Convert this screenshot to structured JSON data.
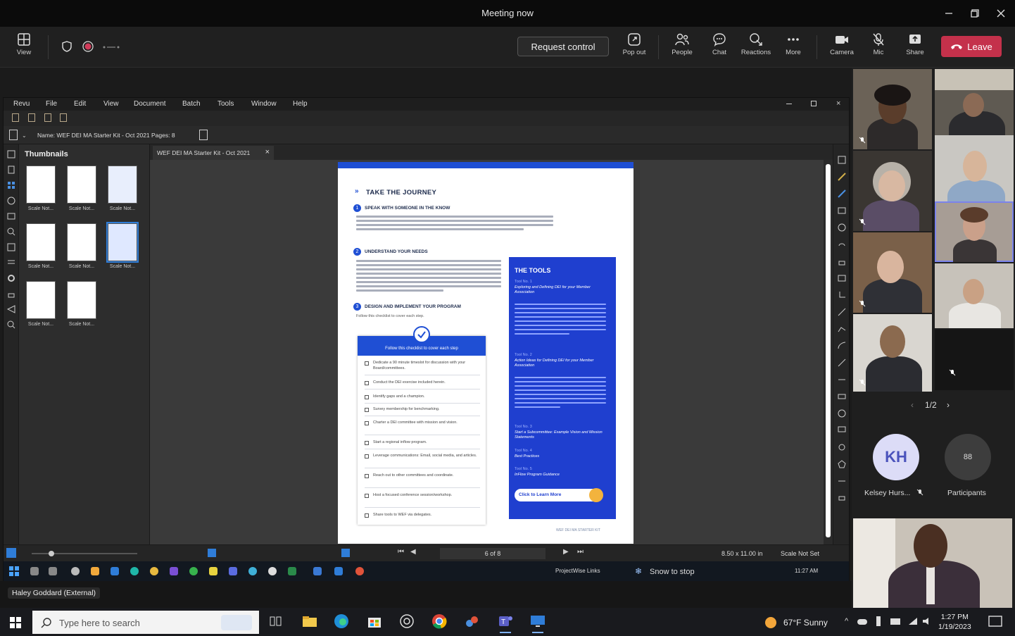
{
  "window": {
    "title": "Meeting now"
  },
  "toolbar": {
    "view_label": "View",
    "request_control": "Request control",
    "popout_label": "Pop out",
    "people_label": "People",
    "chat_label": "Chat",
    "reactions_label": "Reactions",
    "more_label": "More",
    "camera_label": "Camera",
    "mic_label": "Mic",
    "share_label": "Share",
    "leave_label": "Leave"
  },
  "pdf": {
    "menus": [
      "Revu",
      "File",
      "Edit",
      "View",
      "Document",
      "Batch",
      "Tools",
      "Window",
      "Help"
    ],
    "name_line": "Name: WEF DEI MA Starter Kit - Oct 2021   Pages: 8",
    "thumbnails_label": "Thumbnails",
    "tab_label": "WEF DEI MA Starter Kit - Oct 2021",
    "thumb_labels": [
      "Scale Not...",
      "Scale Not...",
      "Scale Not...",
      "Scale Not...",
      "Scale Not...",
      "Scale Not...",
      "Scale Not...",
      "Scale Not..."
    ],
    "page_indicator": "6 of 8",
    "page_size": "8.50 x 11.00 in",
    "scale": "Scale Not Set",
    "inner_taskbar_links": "ProjectWise Links",
    "snow_label": "Snow to stop",
    "inner_time": "11:27 AM"
  },
  "page": {
    "heading": "TAKE THE JOURNEY",
    "step1": "SPEAK WITH SOMEONE IN THE KNOW",
    "step2": "UNDERSTAND YOUR NEEDS",
    "step3": "DESIGN AND IMPLEMENT YOUR PROGRAM",
    "step3_sub": "Follow this checklist to cover each step.",
    "checklist_title": "Follow this checklist to cover each step",
    "checklist": [
      "Dedicate a 90 minute timeslot for discussion with your Board/committees.",
      "Conduct the DEI exercise included herein.",
      "Identify gaps and a champion.",
      "Survey membership for benchmarking.",
      "Charter a DEI committee with mission and vision.",
      "Start a regional inflow program.",
      "Leverage communications: Email, social media, and articles.",
      "Reach out to other committees and coordinate.",
      "Host a focused conference session/workshop.",
      "Share tools to WEF via delegates."
    ],
    "tools_title": "THE TOOLS",
    "tools": [
      {
        "no": "Tool No. 1",
        "title": "Exploring and Defining DEI for your Member Association"
      },
      {
        "no": "Tool No. 2",
        "title": "Action Ideas for Defining DEI for your Member Association"
      },
      {
        "no": "Tool No. 3",
        "title": "Start a Subcommittee: Example Vision and Mission Statements"
      },
      {
        "no": "Tool No. 4",
        "title": "Best Practices"
      },
      {
        "no": "Tool No. 5",
        "title": "InFlow Program Guidance"
      }
    ],
    "learn_more": "Click to Learn More",
    "footer": "WEF DEI MA STARTER KIT"
  },
  "participants": {
    "pager": "1/2",
    "kh_initials": "KH",
    "kh_name": "Kelsey Hurs...",
    "participants_count": "88",
    "participants_label": "Participants"
  },
  "presenter": {
    "name": "Haley Goddard (External)"
  },
  "taskbar": {
    "search_placeholder": "Type here to search",
    "weather": "67°F  Sunny",
    "time": "1:27 PM",
    "date": "1/19/2023"
  },
  "colors": {
    "leave": "#c4314b",
    "accent": "#7b83eb",
    "doc_blue": "#1f4fd4"
  }
}
